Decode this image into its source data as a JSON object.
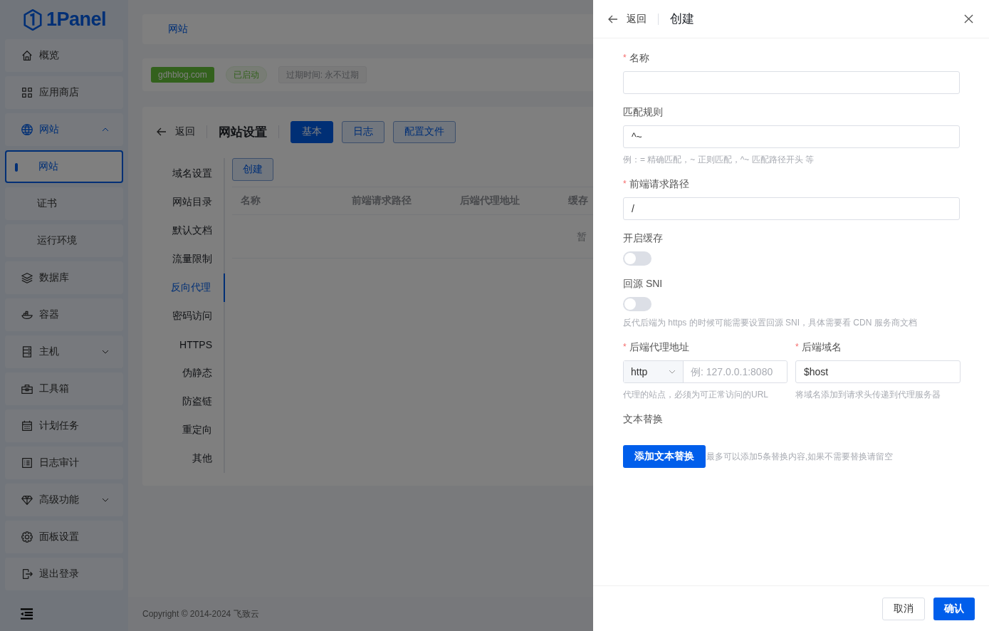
{
  "logo": "1Panel",
  "sidebar": {
    "items": [
      {
        "label": "概览",
        "selected": false
      },
      {
        "label": "应用商店",
        "selected": false
      },
      {
        "label": "网站",
        "selected": false,
        "expanded": true,
        "children": [
          {
            "label": "网站",
            "selected": true
          },
          {
            "label": "证书",
            "selected": false
          },
          {
            "label": "运行环境",
            "selected": false
          }
        ]
      },
      {
        "label": "数据库",
        "selected": false
      },
      {
        "label": "容器",
        "selected": false
      },
      {
        "label": "主机",
        "selected": false,
        "expanded": false
      },
      {
        "label": "工具箱",
        "selected": false
      },
      {
        "label": "计划任务",
        "selected": false
      },
      {
        "label": "日志审计",
        "selected": false
      },
      {
        "label": "高级功能",
        "selected": false,
        "expanded": false
      },
      {
        "label": "面板设置",
        "selected": false
      },
      {
        "label": "退出登录",
        "selected": false
      }
    ]
  },
  "breadcrumb": "网站",
  "site": {
    "domain": "gdhblog.com",
    "status": "已启动",
    "expiry": "过期时间: 永不过期"
  },
  "settings": {
    "back": "返回",
    "title": "网站设置",
    "tabs": [
      {
        "label": "基本",
        "selected": true
      },
      {
        "label": "日志",
        "selected": false
      },
      {
        "label": "配置文件",
        "selected": false
      }
    ],
    "menu": [
      {
        "label": "域名设置",
        "selected": false
      },
      {
        "label": "网站目录",
        "selected": false
      },
      {
        "label": "默认文档",
        "selected": false
      },
      {
        "label": "流量限制",
        "selected": false
      },
      {
        "label": "反向代理",
        "selected": true
      },
      {
        "label": "密码访问",
        "selected": false
      },
      {
        "label": "HTTPS",
        "selected": false
      },
      {
        "label": "伪静态",
        "selected": false
      },
      {
        "label": "防盗链",
        "selected": false
      },
      {
        "label": "重定向",
        "selected": false
      },
      {
        "label": "其他",
        "selected": false
      }
    ],
    "create": "创建",
    "table": {
      "columns": [
        "名称",
        "前端请求路径",
        "后端代理地址",
        "缓存"
      ],
      "empty": "暂"
    }
  },
  "copyright": "Copyright © 2014-2024 飞致云",
  "drawer": {
    "back": "返回",
    "title": "创建",
    "name": {
      "label": "名称",
      "asterisk": "*"
    },
    "match": {
      "label": "匹配规则",
      "value": "^~",
      "help": "例：= 精确匹配，~ 正则匹配，^~ 匹配路径开头 等"
    },
    "path": {
      "label": "前端请求路径",
      "asterisk": "*",
      "value": "/"
    },
    "cache": {
      "label": "开启缓存",
      "on": false
    },
    "sni": {
      "label": "回源 SNI",
      "on": false,
      "help": "反代后端为 https 的时候可能需要设置回源 SNI，具体需要看 CDN 服务商文档"
    },
    "proxy": {
      "label": "后端代理地址",
      "asterisk": "*",
      "scheme": "http",
      "placeholder": "例: 127.0.0.1:8080",
      "help": "代理的站点，必须为可正常访问的URL"
    },
    "host": {
      "label": "后端域名",
      "asterisk": "*",
      "value": "$host",
      "help": "将域名添加到请求头传递到代理服务器"
    },
    "replace": {
      "label": "文本替换",
      "button": "添加文本替换",
      "note": "最多可以添加5条替换内容,如果不需要替换请留空"
    },
    "buttons": {
      "cancel": "取消",
      "confirm": "确认"
    }
  }
}
